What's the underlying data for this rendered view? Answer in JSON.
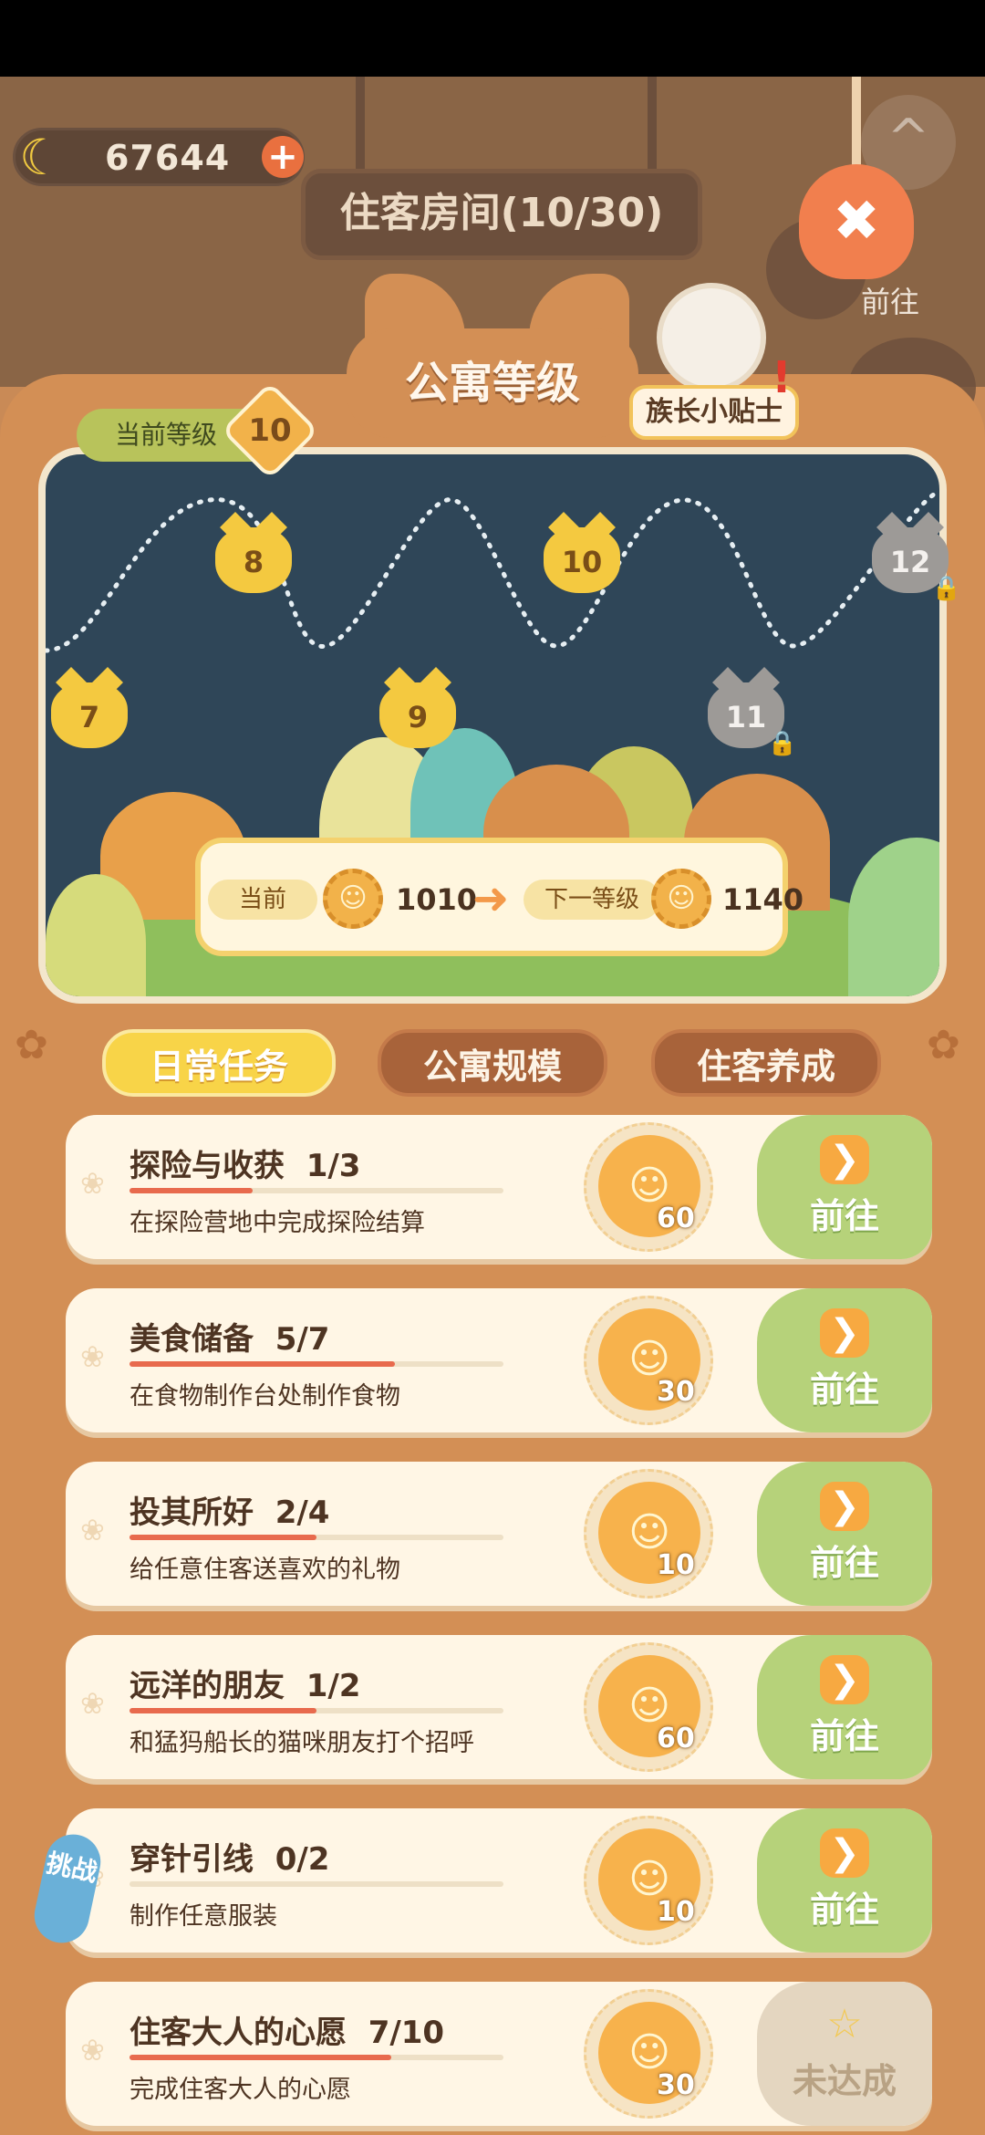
{
  "top_bar": {
    "coin_value": "67644",
    "plus_label": "+",
    "room_title": "住客房间(10/30)",
    "side_go_label": "前往",
    "close_label": "✖",
    "collapse_label": "^"
  },
  "panel": {
    "title": "公寓等级",
    "current_level_label": "当前等级",
    "current_level": "10",
    "tips_label": "族长小贴士",
    "alert": "!"
  },
  "level_map": {
    "nodes": [
      {
        "level": "7",
        "locked": false
      },
      {
        "level": "8",
        "locked": false
      },
      {
        "level": "9",
        "locked": false
      },
      {
        "level": "10",
        "locked": false
      },
      {
        "level": "11",
        "locked": true
      },
      {
        "level": "12",
        "locked": true
      }
    ]
  },
  "progress": {
    "current_label": "当前",
    "current_value": "1010",
    "next_label": "下一等级",
    "next_value": "1140"
  },
  "tabs": [
    {
      "label": "日常任务",
      "active": true
    },
    {
      "label": "公寓规模",
      "active": false
    },
    {
      "label": "住客养成",
      "active": false
    }
  ],
  "tasks": [
    {
      "title": "探险与收获",
      "progress": "1/3",
      "fraction": 0.333,
      "desc": "在探险营地中完成探险结算",
      "reward": "60",
      "action": "前往",
      "done": false
    },
    {
      "title": "美食储备",
      "progress": "5/7",
      "fraction": 0.714,
      "desc": "在食物制作台处制作食物",
      "reward": "30",
      "action": "前往",
      "done": false
    },
    {
      "title": "投其所好",
      "progress": "2/4",
      "fraction": 0.5,
      "desc": "给任意住客送喜欢的礼物",
      "reward": "10",
      "action": "前往",
      "done": false
    },
    {
      "title": "远洋的朋友",
      "progress": "1/2",
      "fraction": 0.5,
      "desc": "和猛犸船长的猫咪朋友打个招呼",
      "reward": "60",
      "action": "前往",
      "done": false
    },
    {
      "title": "穿针引线",
      "progress": "0/2",
      "fraction": 0,
      "desc": "制作任意服装",
      "reward": "10",
      "action": "前往",
      "done": false
    },
    {
      "title": "住客大人的心愿",
      "progress": "7/10",
      "fraction": 0.7,
      "desc": "完成住客大人的心愿",
      "reward": "30",
      "action": "未达成",
      "done": true
    }
  ],
  "challenge_label": "挑战",
  "colors": {
    "panel": "#d38f55",
    "go_green": "#b6d27a",
    "progress_red": "#e86a4d",
    "tab_yellow": "#f8d448"
  }
}
